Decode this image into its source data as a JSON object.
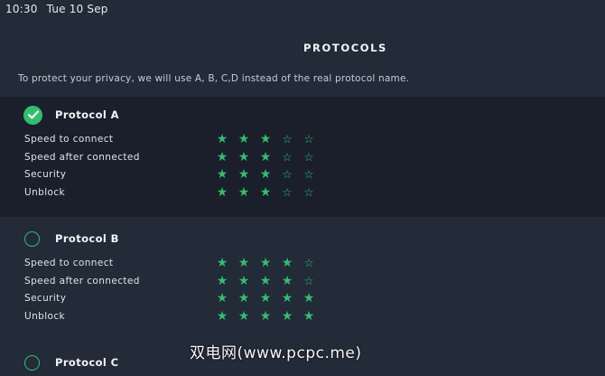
{
  "status_bar": {
    "time": "10:30",
    "date": "Tue 10 Sep"
  },
  "page_title": "PROTOCOLS",
  "privacy_note": "To protect your privacy, we will use A, B, C,D instead of the real protocol name.",
  "colors": {
    "accent": "#2fbf6e",
    "background": "#232a38",
    "selected_row": "#1a1f2b"
  },
  "protocols": [
    {
      "name": "Protocol A",
      "selected": true,
      "metrics": [
        {
          "label": "Speed to connect",
          "rating": 3,
          "max": 5
        },
        {
          "label": "Speed after connected",
          "rating": 3,
          "max": 5
        },
        {
          "label": "Security",
          "rating": 3,
          "max": 5
        },
        {
          "label": "Unblock",
          "rating": 3,
          "max": 5
        }
      ]
    },
    {
      "name": "Protocol B",
      "selected": false,
      "metrics": [
        {
          "label": "Speed to connect",
          "rating": 4,
          "max": 5
        },
        {
          "label": "Speed after connected",
          "rating": 4,
          "max": 5
        },
        {
          "label": "Security",
          "rating": 5,
          "max": 5
        },
        {
          "label": "Unblock",
          "rating": 5,
          "max": 5
        }
      ]
    },
    {
      "name": "Protocol C",
      "selected": false,
      "metrics": []
    }
  ],
  "watermark": "双电网(www.pcpc.me)",
  "icons": {
    "selected": "checkmark-circle-icon",
    "unselected": "radio-circle-icon",
    "star_filled": "star-filled-icon",
    "star_empty": "star-outline-icon"
  }
}
